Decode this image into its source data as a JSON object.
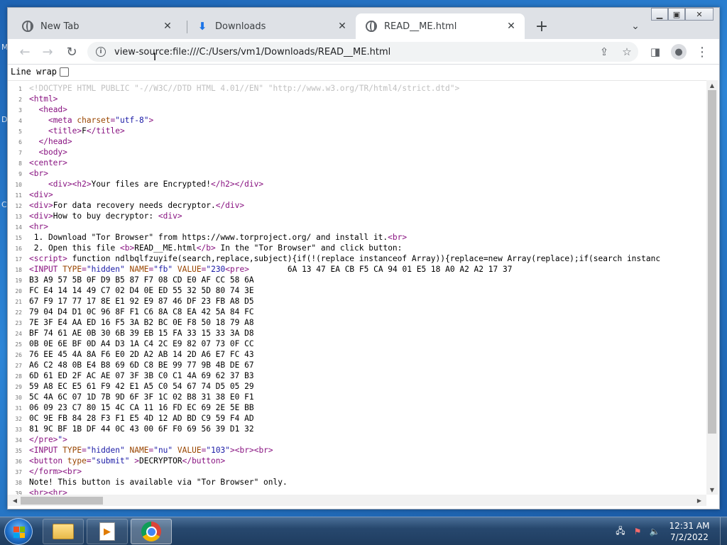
{
  "browser": {
    "tabs": [
      {
        "label": "New Tab",
        "icon": "globe-icon"
      },
      {
        "label": "Downloads",
        "icon": "download-icon"
      },
      {
        "label": "READ__ME.html",
        "icon": "globe-icon",
        "active": true
      }
    ],
    "address": "view-source:file:///C:/Users/vm1/Downloads/READ__ME.html",
    "line_wrap_label": "Line wrap",
    "line_wrap_checked": false
  },
  "source_lines": [
    {
      "n": "1",
      "parts": [
        [
          "doctype",
          "<!DOCTYPE HTML PUBLIC \"-//W3C//DTD HTML 4.01//EN\" \"http://www.w3.org/TR/html4/strict.dtd\">"
        ]
      ]
    },
    {
      "n": "2",
      "parts": [
        [
          "tag",
          "<html>"
        ]
      ]
    },
    {
      "n": "3",
      "parts": [
        [
          "txt",
          "  "
        ],
        [
          "tag",
          "<head>"
        ]
      ]
    },
    {
      "n": "4",
      "parts": [
        [
          "txt",
          "    "
        ],
        [
          "tag",
          "<meta "
        ],
        [
          "attr",
          "charset"
        ],
        [
          "tag",
          "="
        ],
        [
          "val",
          "\"utf-8\""
        ],
        [
          "tag",
          ">"
        ]
      ]
    },
    {
      "n": "5",
      "parts": [
        [
          "txt",
          "    "
        ],
        [
          "tag",
          "<title>"
        ],
        [
          "txt",
          "F"
        ],
        [
          "tag",
          "</title>"
        ]
      ]
    },
    {
      "n": "6",
      "parts": [
        [
          "txt",
          "  "
        ],
        [
          "tag",
          "</head>"
        ]
      ]
    },
    {
      "n": "7",
      "parts": [
        [
          "txt",
          "  "
        ],
        [
          "tag",
          "<body>"
        ]
      ]
    },
    {
      "n": "8",
      "parts": [
        [
          "tag",
          "<center>"
        ]
      ]
    },
    {
      "n": "9",
      "parts": [
        [
          "tag",
          "<br>"
        ]
      ]
    },
    {
      "n": "10",
      "parts": [
        [
          "txt",
          "    "
        ],
        [
          "tag",
          "<div><h2>"
        ],
        [
          "txt",
          "Your files are Encrypted!"
        ],
        [
          "tag",
          "</h2></div>"
        ]
      ]
    },
    {
      "n": "11",
      "parts": [
        [
          "tag",
          "<div>"
        ]
      ]
    },
    {
      "n": "12",
      "parts": [
        [
          "tag",
          "<div>"
        ],
        [
          "txt",
          "For data recovery needs decryptor."
        ],
        [
          "tag",
          "</div>"
        ]
      ]
    },
    {
      "n": "13",
      "parts": [
        [
          "tag",
          "<div>"
        ],
        [
          "txt",
          "How to buy decryptor: "
        ],
        [
          "tag",
          "<div>"
        ]
      ]
    },
    {
      "n": "14",
      "parts": [
        [
          "tag",
          "<hr>"
        ]
      ]
    },
    {
      "n": "15",
      "parts": [
        [
          "txt",
          " 1. Download \"Tor Browser\" from https://www.torproject.org/ and install it."
        ],
        [
          "tag",
          "<br>"
        ]
      ]
    },
    {
      "n": "16",
      "parts": [
        [
          "txt",
          " 2. Open this file "
        ],
        [
          "tag",
          "<b>"
        ],
        [
          "txt",
          "READ__ME.html"
        ],
        [
          "tag",
          "</b>"
        ],
        [
          "txt",
          " In the \"Tor Browser\" and click button:"
        ]
      ]
    },
    {
      "n": "17",
      "parts": [
        [
          "tag",
          "<script>"
        ],
        [
          "txt",
          " function ndlbqlfzuyife(search,replace,subject){if(!(replace instanceof Array)){replace=new Array(replace);if(search instanc"
        ]
      ]
    },
    {
      "n": "18",
      "parts": [
        [
          "tag",
          "<INPUT "
        ],
        [
          "attr",
          "TYPE"
        ],
        [
          "tag",
          "="
        ],
        [
          "val",
          "\"hidden\""
        ],
        [
          "tag",
          " "
        ],
        [
          "attr",
          "NAME"
        ],
        [
          "tag",
          "="
        ],
        [
          "val",
          "\"fb\""
        ],
        [
          "tag",
          " "
        ],
        [
          "attr",
          "VALUE"
        ],
        [
          "tag",
          "="
        ],
        [
          "val",
          "\"230"
        ],
        [
          "tag",
          "<pre>"
        ],
        [
          "txt",
          "        6A 13 47 EA CB F5 CA 94 01 E5 18 A0 A2 A2 17 37"
        ]
      ]
    },
    {
      "n": "19",
      "parts": [
        [
          "txt",
          "B3 A9 57 5B 0F D9 B5 87 F7 08 CD E0 AF CC 58 6A"
        ]
      ]
    },
    {
      "n": "20",
      "parts": [
        [
          "txt",
          "FC E4 14 14 49 C7 02 D4 0E ED 55 32 5D 80 74 3E"
        ]
      ]
    },
    {
      "n": "21",
      "parts": [
        [
          "txt",
          "67 F9 17 77 17 8E E1 92 E9 87 46 DF 23 FB A8 D5"
        ]
      ]
    },
    {
      "n": "22",
      "parts": [
        [
          "txt",
          "79 04 D4 D1 0C 96 8F F1 C6 8A C8 EA 42 5A 84 FC"
        ]
      ]
    },
    {
      "n": "23",
      "parts": [
        [
          "txt",
          "7E 3F E4 AA ED 16 F5 3A B2 BC 0E F8 50 18 79 A8"
        ]
      ]
    },
    {
      "n": "24",
      "parts": [
        [
          "txt",
          "BF 74 61 AE 0B 30 6B 39 EB 15 FA 33 15 33 3A D8"
        ]
      ]
    },
    {
      "n": "25",
      "parts": [
        [
          "txt",
          "0B 0E 6E BF 0D A4 D3 1A C4 2C E9 82 07 73 0F CC"
        ]
      ]
    },
    {
      "n": "26",
      "parts": [
        [
          "txt",
          "76 EE 45 4A 8A F6 E0 2D A2 AB 14 2D A6 E7 FC 43"
        ]
      ]
    },
    {
      "n": "27",
      "parts": [
        [
          "txt",
          "A6 C2 48 0B E4 B8 69 6D C8 BE 99 77 9B 4B DE 67"
        ]
      ]
    },
    {
      "n": "28",
      "parts": [
        [
          "txt",
          "6D 61 ED 2F AC AE 07 3F 3B C0 C1 4A 69 62 37 B3"
        ]
      ]
    },
    {
      "n": "29",
      "parts": [
        [
          "txt",
          "59 A8 EC E5 61 F9 42 E1 A5 C0 54 67 74 D5 05 29"
        ]
      ]
    },
    {
      "n": "30",
      "parts": [
        [
          "txt",
          "5C 4A 6C 07 1D 7B 9D 6F 3F 1C 02 B8 31 38 E0 F1"
        ]
      ]
    },
    {
      "n": "31",
      "parts": [
        [
          "txt",
          "06 09 23 C7 80 15 4C CA 11 16 FD EC 69 2E 5E BB"
        ]
      ]
    },
    {
      "n": "32",
      "parts": [
        [
          "txt",
          "0C 9E FB 84 28 F3 F1 E5 4D 12 AD BD C9 59 F4 AD"
        ]
      ]
    },
    {
      "n": "33",
      "parts": [
        [
          "txt",
          "81 9C BF 1B DF 44 0C 43 00 6F F0 69 56 39 D1 32"
        ]
      ]
    },
    {
      "n": "34",
      "parts": [
        [
          "tag",
          "</pre>"
        ],
        [
          "val",
          "\""
        ],
        [
          "tag",
          ">"
        ]
      ]
    },
    {
      "n": "35",
      "parts": [
        [
          "tag",
          "<INPUT "
        ],
        [
          "attr",
          "TYPE"
        ],
        [
          "tag",
          "="
        ],
        [
          "val",
          "\"hidden\""
        ],
        [
          "tag",
          " "
        ],
        [
          "attr",
          "NAME"
        ],
        [
          "tag",
          "="
        ],
        [
          "val",
          "\"nu\""
        ],
        [
          "tag",
          " "
        ],
        [
          "attr",
          "VALUE"
        ],
        [
          "tag",
          "="
        ],
        [
          "val",
          "\"103\""
        ],
        [
          "tag",
          "><br><br>"
        ]
      ]
    },
    {
      "n": "36",
      "parts": [
        [
          "tag",
          "<button "
        ],
        [
          "attr",
          "type"
        ],
        [
          "tag",
          "="
        ],
        [
          "val",
          "\"submit\""
        ],
        [
          "tag",
          " >"
        ],
        [
          "txt",
          "DECRYPTOR"
        ],
        [
          "tag",
          "</button>"
        ]
      ]
    },
    {
      "n": "37",
      "parts": [
        [
          "tag",
          "</form><br>"
        ]
      ]
    },
    {
      "n": "38",
      "parts": [
        [
          "txt",
          "Note! This button is available via \"Tor Browser\" only."
        ]
      ]
    },
    {
      "n": "39",
      "parts": [
        [
          "tag",
          "<br><hr>"
        ]
      ]
    }
  ],
  "taskbar": {
    "time": "12:31 AM",
    "date": "7/2/2022",
    "apps": [
      "folder-icon",
      "media-player-icon",
      "chrome-icon"
    ]
  },
  "colors": {
    "tag": "#881280",
    "attr": "#994500",
    "value": "#1a1aa6",
    "doctype": "#c0c0c0"
  }
}
